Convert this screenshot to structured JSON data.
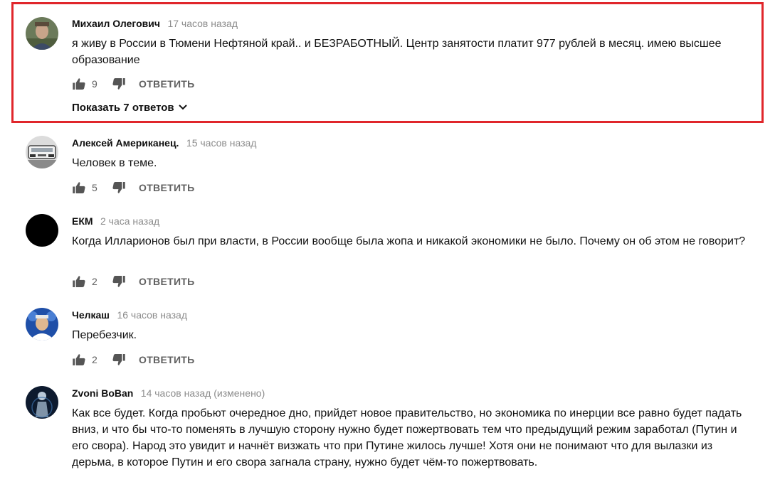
{
  "reply_label": "ОТВЕТИТЬ",
  "comments": [
    {
      "author": "Михаил Олегович",
      "time": "17 часов назад",
      "text": "я живу в России в Тюмени Нефтяной край.. и БЕЗРАБОТНЫЙ. Центр занятости платит 977 рублей в месяц. имею высшее образование",
      "likes": "9",
      "show_replies": "Показать 7 ответов"
    },
    {
      "author": "Алексей Американец.",
      "time": "15 часов назад",
      "text": "Человек в теме.",
      "likes": "5"
    },
    {
      "author": "ЕКМ",
      "time": "2 часа назад",
      "text": "Когда Илларионов был при власти,  в России вообще была жопа и никакой экономики не было. Почему он об этом не говорит?",
      "likes": "2"
    },
    {
      "author": "Челкаш",
      "time": "16 часов назад",
      "text": "Перебезчик.",
      "likes": "2"
    },
    {
      "author": "Zvoni BoBan",
      "time": "14 часов назад (изменено)",
      "text": "Как все будет. Когда пробьют очередное дно, прийдет новое правительство, но экономика по инерции все равно будет падать вниз, и что бы что-то поменять в лучшую сторону нужно будет пожертвовать тем что предыдущий режим заработал (Путин и его свора). Народ это увидит и начнёт визжать что при Путине жилось лучше! Хотя они не понимают что для вылазки из дерьма, в которое Путин и его свора загнала страну, нужно будет чём-то пожертвовать."
    }
  ],
  "colors": {
    "highlight_border": "#e0262b",
    "author": "#0f0f0f",
    "timestamp": "#8c8c8c",
    "action": "#606060"
  },
  "icons": {
    "like": "thumbs-up-icon",
    "dislike": "thumbs-down-icon",
    "expand": "chevron-down-icon"
  }
}
